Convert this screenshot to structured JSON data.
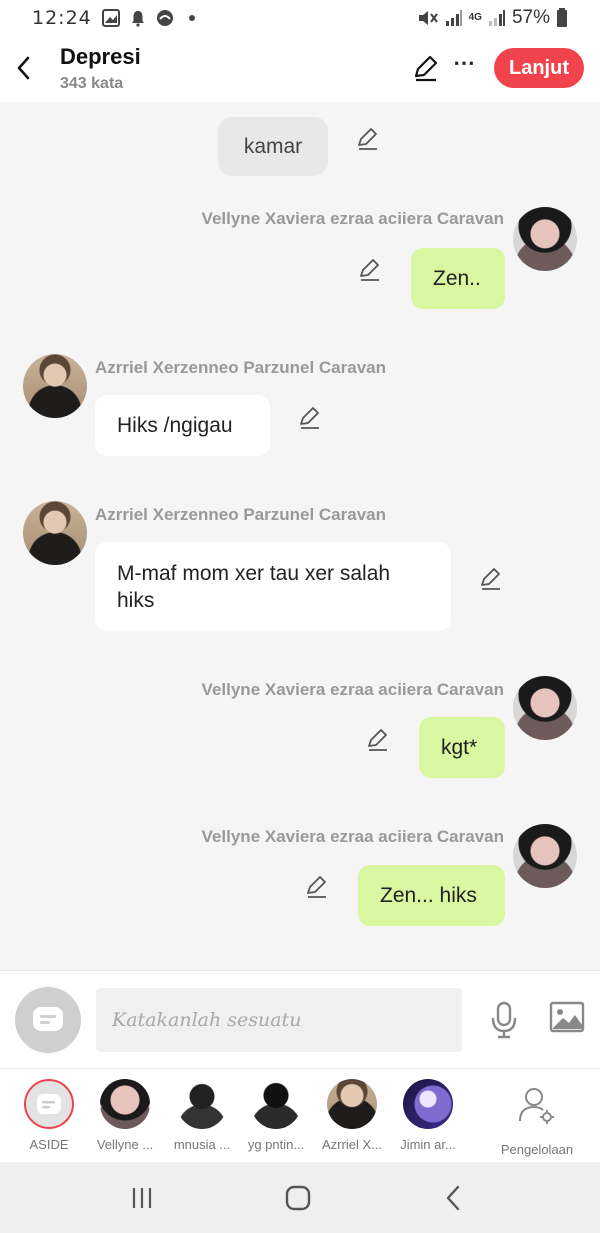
{
  "status_bar": {
    "time": "12:24",
    "battery": "57%",
    "network": "4G"
  },
  "header": {
    "title": "Depresi",
    "word_count": "343 kata",
    "continue_label": "Lanjut",
    "more_label": "⋯"
  },
  "messages": [
    {
      "type": "narration",
      "text": "kamar"
    },
    {
      "side": "right",
      "sender": "Vellyne Xaviera ezraa aciiera Caravan",
      "text": "Zen.."
    },
    {
      "side": "left",
      "sender": "Azrriel Xerzenneo Parzunel Caravan",
      "text": "Hiks /ngigau"
    },
    {
      "side": "left",
      "sender": "Azrriel Xerzenneo Parzunel Caravan",
      "text": "M-maf mom xer tau xer salah hiks"
    },
    {
      "side": "right",
      "sender": "Vellyne Xaviera ezraa aciiera Caravan",
      "text": "kgt*"
    },
    {
      "side": "right",
      "sender": "Vellyne Xaviera ezraa aciiera Caravan",
      "text": "Zen... hiks"
    }
  ],
  "composer": {
    "placeholder": "Katakanlah sesuatu"
  },
  "characters": [
    {
      "label": "ASIDE"
    },
    {
      "label": "Vellyne ..."
    },
    {
      "label": "mnusia ..."
    },
    {
      "label": "yg pntin..."
    },
    {
      "label": "Azrriel X..."
    },
    {
      "label": "Jimin ar..."
    },
    {
      "label": "Pengelolaan"
    }
  ],
  "colors": {
    "accent": "#f0434b",
    "user_bubble": "#d9f7a0",
    "other_bubble": "#ffffff",
    "narration_bubble": "#e8e8e8"
  }
}
